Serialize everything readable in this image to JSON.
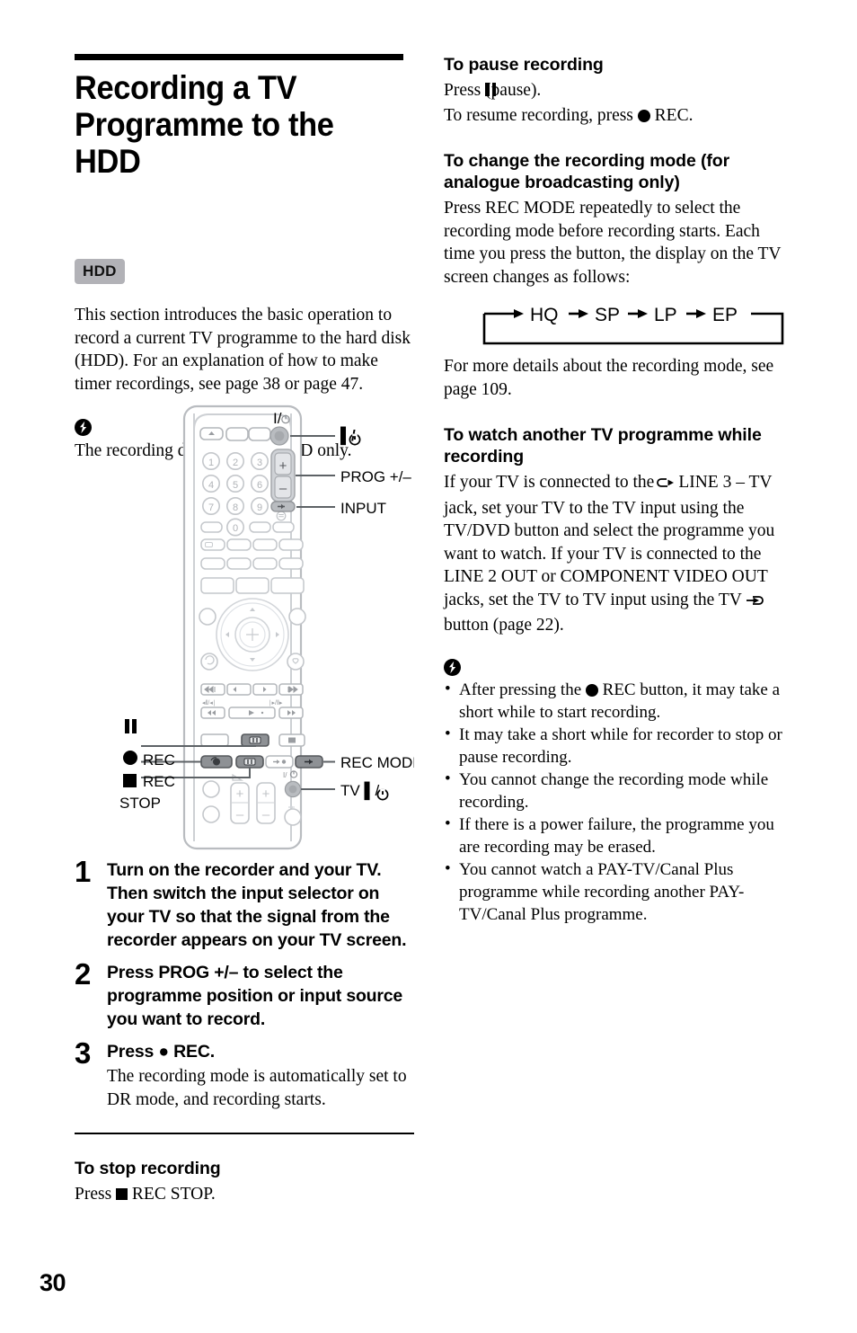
{
  "page": {
    "number": "30"
  },
  "left": {
    "title": "Recording a TV Programme to the HDD",
    "badge": "HDD",
    "intro": "This section introduces the basic operation to record a current TV programme to the hard disk (HDD). For an explanation of how to make timer recordings, see page 38 or page 47.",
    "note": "The recording destination is HDD only.",
    "steps": [
      {
        "number": "1",
        "head": "Turn on the recorder and your TV. Then switch the input selector on your TV so that the signal from the recorder appears on your TV screen.",
        "desc": ""
      },
      {
        "number": "2",
        "head": "Press PROG +/– to select the programme position or input source you want to record.",
        "desc": ""
      },
      {
        "number": "3",
        "head": "Press ● REC.",
        "desc": "The recording mode is automatically set to DR mode, and recording starts."
      }
    ],
    "stop_heading": "To stop recording",
    "stop_text_before": "Press",
    "stop_text_after": "REC STOP."
  },
  "remote": {
    "callouts": [
      {
        "label": "I/⏻",
        "name": "power-callout"
      },
      {
        "label": "PROG +/–",
        "name": "prog-callout"
      },
      {
        "label": "INPUT",
        "name": "input-callout"
      },
      {
        "label": "REC MODE",
        "name": "rec-mode-callout"
      },
      {
        "label": "TV I/⏻",
        "name": "tv-power-callout"
      }
    ],
    "left_callouts": [
      {
        "label": "",
        "name": "pause-callout"
      },
      {
        "label": "REC",
        "name": "rec-callout"
      },
      {
        "label": "REC",
        "name": "rec-stop-callout"
      },
      {
        "label": "STOP",
        "name": "rec-stop-second-line"
      }
    ],
    "keypad_digits": [
      "1",
      "2",
      "3",
      "4",
      "5",
      "6",
      "7",
      "8",
      "9",
      "0"
    ],
    "power_glyph": "I/⏻"
  },
  "right": {
    "pause_heading": "To pause recording",
    "pause_line1_before": "Press",
    "pause_line1_after": "(pause).",
    "pause_line2_before": "To resume recording, press",
    "pause_line2_after": "REC.",
    "mode_heading": "To change the recording mode (for analogue broadcasting only)",
    "mode_text": "Press REC MODE repeatedly to select the recording mode before recording starts. Each time you press the button, the display on the TV screen changes as follows:",
    "mode_flow": [
      "HQ",
      "SP",
      "LP",
      "EP"
    ],
    "mode_after": "For more details about the recording mode, see page 109.",
    "watch_heading": "To watch another TV programme while recording",
    "watch_text_1": "If your TV is connected to the",
    "watch_text_2": "LINE 3 – TV jack, set your TV to the TV input using the TV/DVD button and select the programme you want to watch. If your TV is connected to the LINE 2 OUT or COMPONENT VIDEO OUT jacks, set the TV to TV input using the TV",
    "watch_text_3": "button (page 22).",
    "bullets": [
      {
        "before": "After pressing the",
        "after": "REC button, it may take a short while to start recording."
      },
      {
        "before": "",
        "after": "It may take a short while for recorder to stop or pause recording."
      },
      {
        "before": "",
        "after": "You cannot change the recording mode while recording."
      },
      {
        "before": "",
        "after": "If there is a power failure, the programme you are recording may be erased."
      },
      {
        "before": "",
        "after": "You cannot watch a PAY-TV/Canal Plus programme while recording another PAY-TV/Canal Plus programme."
      }
    ]
  }
}
